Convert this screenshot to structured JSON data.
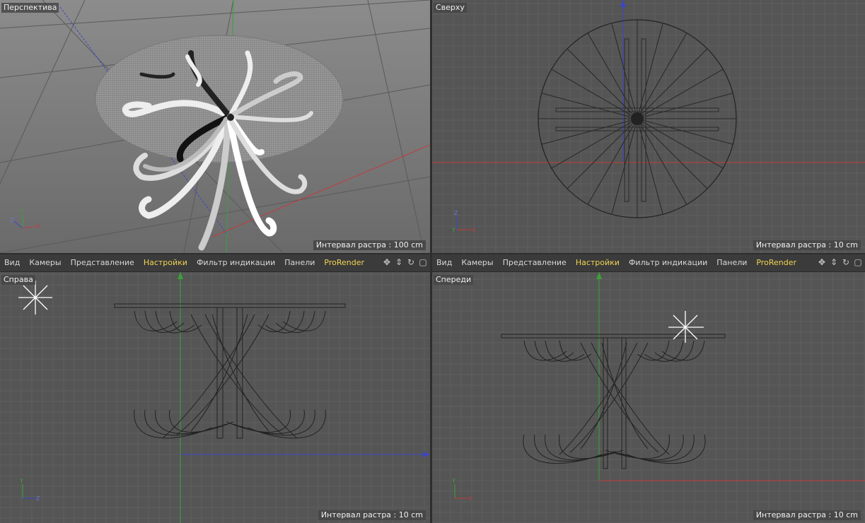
{
  "viewports": [
    {
      "id": "perspective",
      "title": "Перспектива",
      "interval": "Интервал растра : 100 cm"
    },
    {
      "id": "top",
      "title": "Сверху",
      "interval": "Интервал растра : 10 cm"
    },
    {
      "id": "right",
      "title": "Справа",
      "interval": "Интервал растра : 10 cm"
    },
    {
      "id": "front",
      "title": "Спереди",
      "interval": "Интервал растра : 10 cm"
    }
  ],
  "menubar": {
    "items": [
      "Вид",
      "Камеры",
      "Представление",
      "Настройки",
      "Фильтр индикации",
      "Панели",
      "ProRender"
    ],
    "highlighted": [
      "Настройки",
      "ProRender"
    ],
    "icons": [
      "move-view-icon",
      "zoom-view-icon",
      "rotate-view-icon",
      "maximize-view-icon"
    ]
  },
  "axis_labels": {
    "x": "X",
    "y": "Y",
    "z": "Z"
  },
  "colors": {
    "x_axis": "#c33c3c",
    "y_axis": "#3aa13a",
    "z_axis": "#3c46c8",
    "highlight_menu": "#f2d552"
  }
}
